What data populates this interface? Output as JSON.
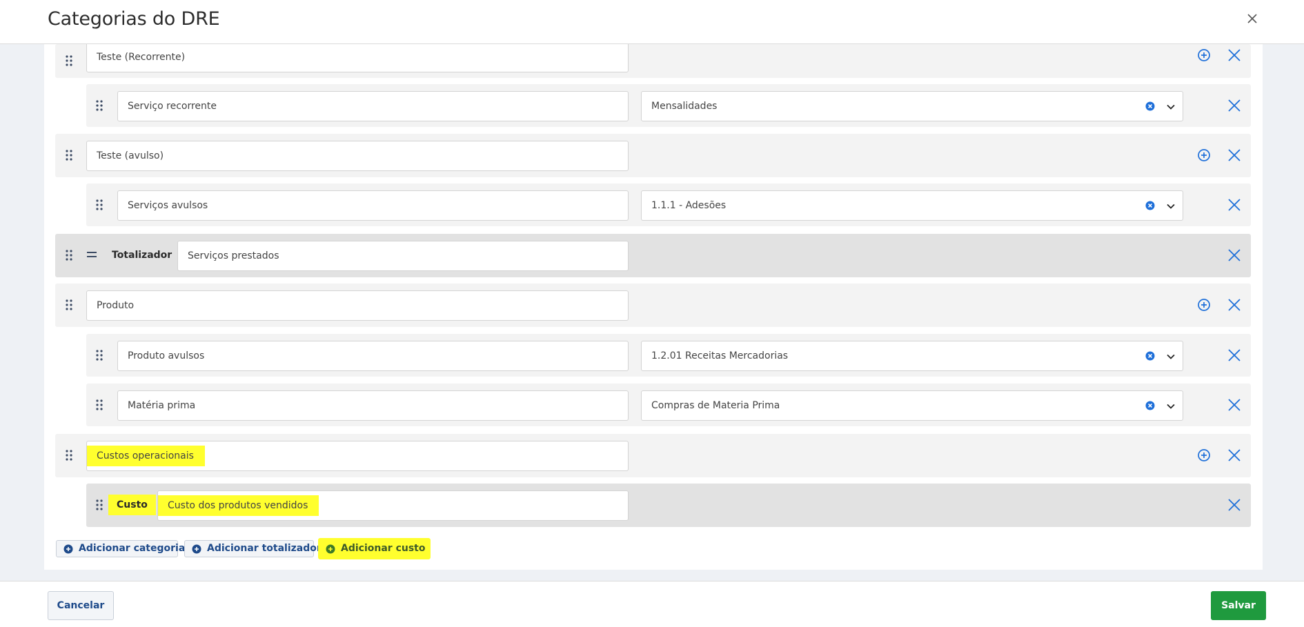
{
  "modal": {
    "title": "Categorias do DRE"
  },
  "rows": [
    {
      "name": "Teste (Recorrente)"
    },
    {
      "name": "Serviço recorrente",
      "account": "Mensalidades"
    },
    {
      "name": "Teste (avulso)"
    },
    {
      "name": "Serviços avulsos",
      "account": "1.1.1 - Adesões"
    },
    {
      "type_label": "Totalizador",
      "name": "Serviços prestados"
    },
    {
      "name": "Produto"
    },
    {
      "name": "Produto avulsos",
      "account": "1.2.01 Receitas Mercadorias"
    },
    {
      "name": "Matéria prima",
      "account": "Compras de Materia Prima"
    },
    {
      "name": "Custos operacionais"
    },
    {
      "type_label": "Custo",
      "name": "Custo dos produtos vendidos"
    }
  ],
  "actions": {
    "add_category": "Adicionar categoria",
    "add_totalizer": "Adicionar totalizador",
    "add_cost": "Adicionar custo"
  },
  "footer": {
    "cancel": "Cancelar",
    "save": "Salvar"
  },
  "colors": {
    "accent": "#1e6fd9",
    "save": "#1f9a3e",
    "highlight": "#ffff2e"
  },
  "icons": {
    "drag": "drag-handle-icon",
    "add": "plus-circle-icon",
    "remove": "close-icon",
    "clear": "clear-circle-icon",
    "dropdown": "chevron-down-icon",
    "totalizer": "equals-icon"
  }
}
